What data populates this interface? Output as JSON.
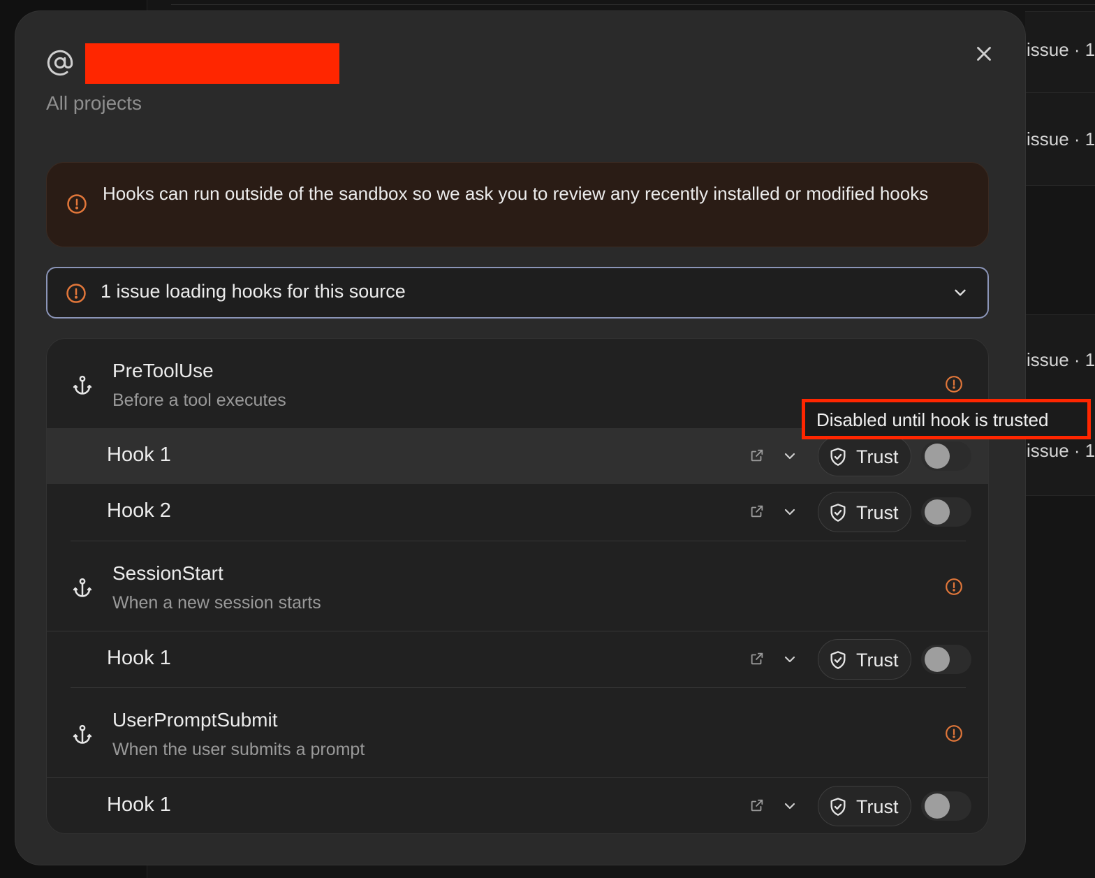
{
  "background": {
    "rows": [
      "issue · 1",
      "issue · 1",
      "issue · 1",
      "issue · 1"
    ]
  },
  "modal": {
    "subtitle": "All projects",
    "icons": {
      "title": "at-sign-icon",
      "close": "close-icon"
    },
    "warning": {
      "icon": "alert-circle-icon",
      "text": "Hooks can run outside of the sandbox so we ask you to review any recently installed or modified hooks"
    },
    "issue": {
      "icon": "alert-circle-icon",
      "text": "1 issue loading hooks for this source",
      "chevron": "chevron-down-icon"
    },
    "groups": [
      {
        "name": "PreToolUse",
        "description": "Before a tool executes",
        "hooks": [
          {
            "name": "Hook 1",
            "trust_label": "Trust",
            "enabled": false
          },
          {
            "name": "Hook 2",
            "trust_label": "Trust",
            "enabled": false
          }
        ]
      },
      {
        "name": "SessionStart",
        "description": "When a new session starts",
        "hooks": [
          {
            "name": "Hook 1",
            "trust_label": "Trust",
            "enabled": false
          }
        ]
      },
      {
        "name": "UserPromptSubmit",
        "description": "When the user submits a prompt",
        "hooks": [
          {
            "name": "Hook 1",
            "trust_label": "Trust",
            "enabled": false
          }
        ]
      }
    ],
    "tooltip": "Disabled until hook is trusted"
  },
  "colors": {
    "warning_accent": "#e2773a",
    "redaction": "#ff2600",
    "issue_border": "#8b95b8"
  }
}
